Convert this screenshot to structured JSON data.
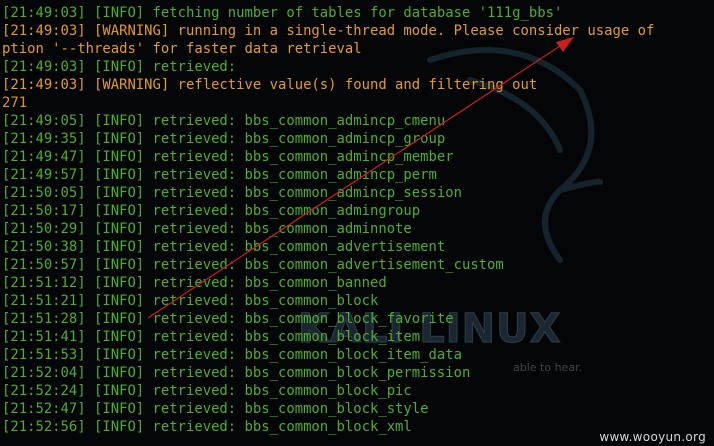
{
  "terminal": {
    "lines": [
      {
        "kind": "info",
        "text": "[21:49:03] [INFO] fetching number of tables for database '111g_bbs'"
      },
      {
        "kind": "warn",
        "text": "[21:49:03] [WARNING] running in a single-thread mode. Please consider usage of"
      },
      {
        "kind": "warn",
        "text": "ption '--threads' for faster data retrieval"
      },
      {
        "kind": "info",
        "text": "[21:49:03] [INFO] retrieved:"
      },
      {
        "kind": "warn",
        "text": "[21:49:03] [WARNING] reflective value(s) found and filtering out"
      },
      {
        "kind": "count",
        "text": "271"
      },
      {
        "kind": "info",
        "text": "[21:49:05] [INFO] retrieved: bbs_common_admincp_cmenu"
      },
      {
        "kind": "info",
        "text": "[21:49:35] [INFO] retrieved: bbs_common_admincp_group"
      },
      {
        "kind": "info",
        "text": "[21:49:47] [INFO] retrieved: bbs_common_admincp_member"
      },
      {
        "kind": "info",
        "text": "[21:49:57] [INFO] retrieved: bbs_common_admincp_perm"
      },
      {
        "kind": "info",
        "text": "[21:50:05] [INFO] retrieved: bbs_common_admincp_session"
      },
      {
        "kind": "info",
        "text": "[21:50:17] [INFO] retrieved: bbs_common_admingroup"
      },
      {
        "kind": "info",
        "text": "[21:50:29] [INFO] retrieved: bbs_common_adminnote"
      },
      {
        "kind": "info",
        "text": "[21:50:38] [INFO] retrieved: bbs_common_advertisement"
      },
      {
        "kind": "info",
        "text": "[21:50:57] [INFO] retrieved: bbs_common_advertisement_custom"
      },
      {
        "kind": "info",
        "text": "[21:51:12] [INFO] retrieved: bbs_common_banned"
      },
      {
        "kind": "info",
        "text": "[21:51:21] [INFO] retrieved: bbs_common_block"
      },
      {
        "kind": "info",
        "text": "[21:51:28] [INFO] retrieved: bbs_common_block_favorite"
      },
      {
        "kind": "info",
        "text": "[21:51:41] [INFO] retrieved: bbs_common_block_item"
      },
      {
        "kind": "info",
        "text": "[21:51:53] [INFO] retrieved: bbs_common_block_item_data"
      },
      {
        "kind": "info",
        "text": "[21:52:04] [INFO] retrieved: bbs_common_block_permission"
      },
      {
        "kind": "info",
        "text": "[21:52:24] [INFO] retrieved: bbs_common_block_pic"
      },
      {
        "kind": "info",
        "text": "[21:52:47] [INFO] retrieved: bbs_common_block_style"
      },
      {
        "kind": "info",
        "text": "[21:52:56] [INFO] retrieved: bbs_common_block_xml"
      }
    ]
  },
  "wallpaper": {
    "logo_text": "KALI LINUX",
    "tagline_fragment": "able to hear."
  },
  "watermark": "www.wooyun.org",
  "colors": {
    "background": "#040506",
    "info_text": "#4fae2a",
    "warning_text": "#e39d24",
    "annotation_arrow": "#c8201c"
  }
}
